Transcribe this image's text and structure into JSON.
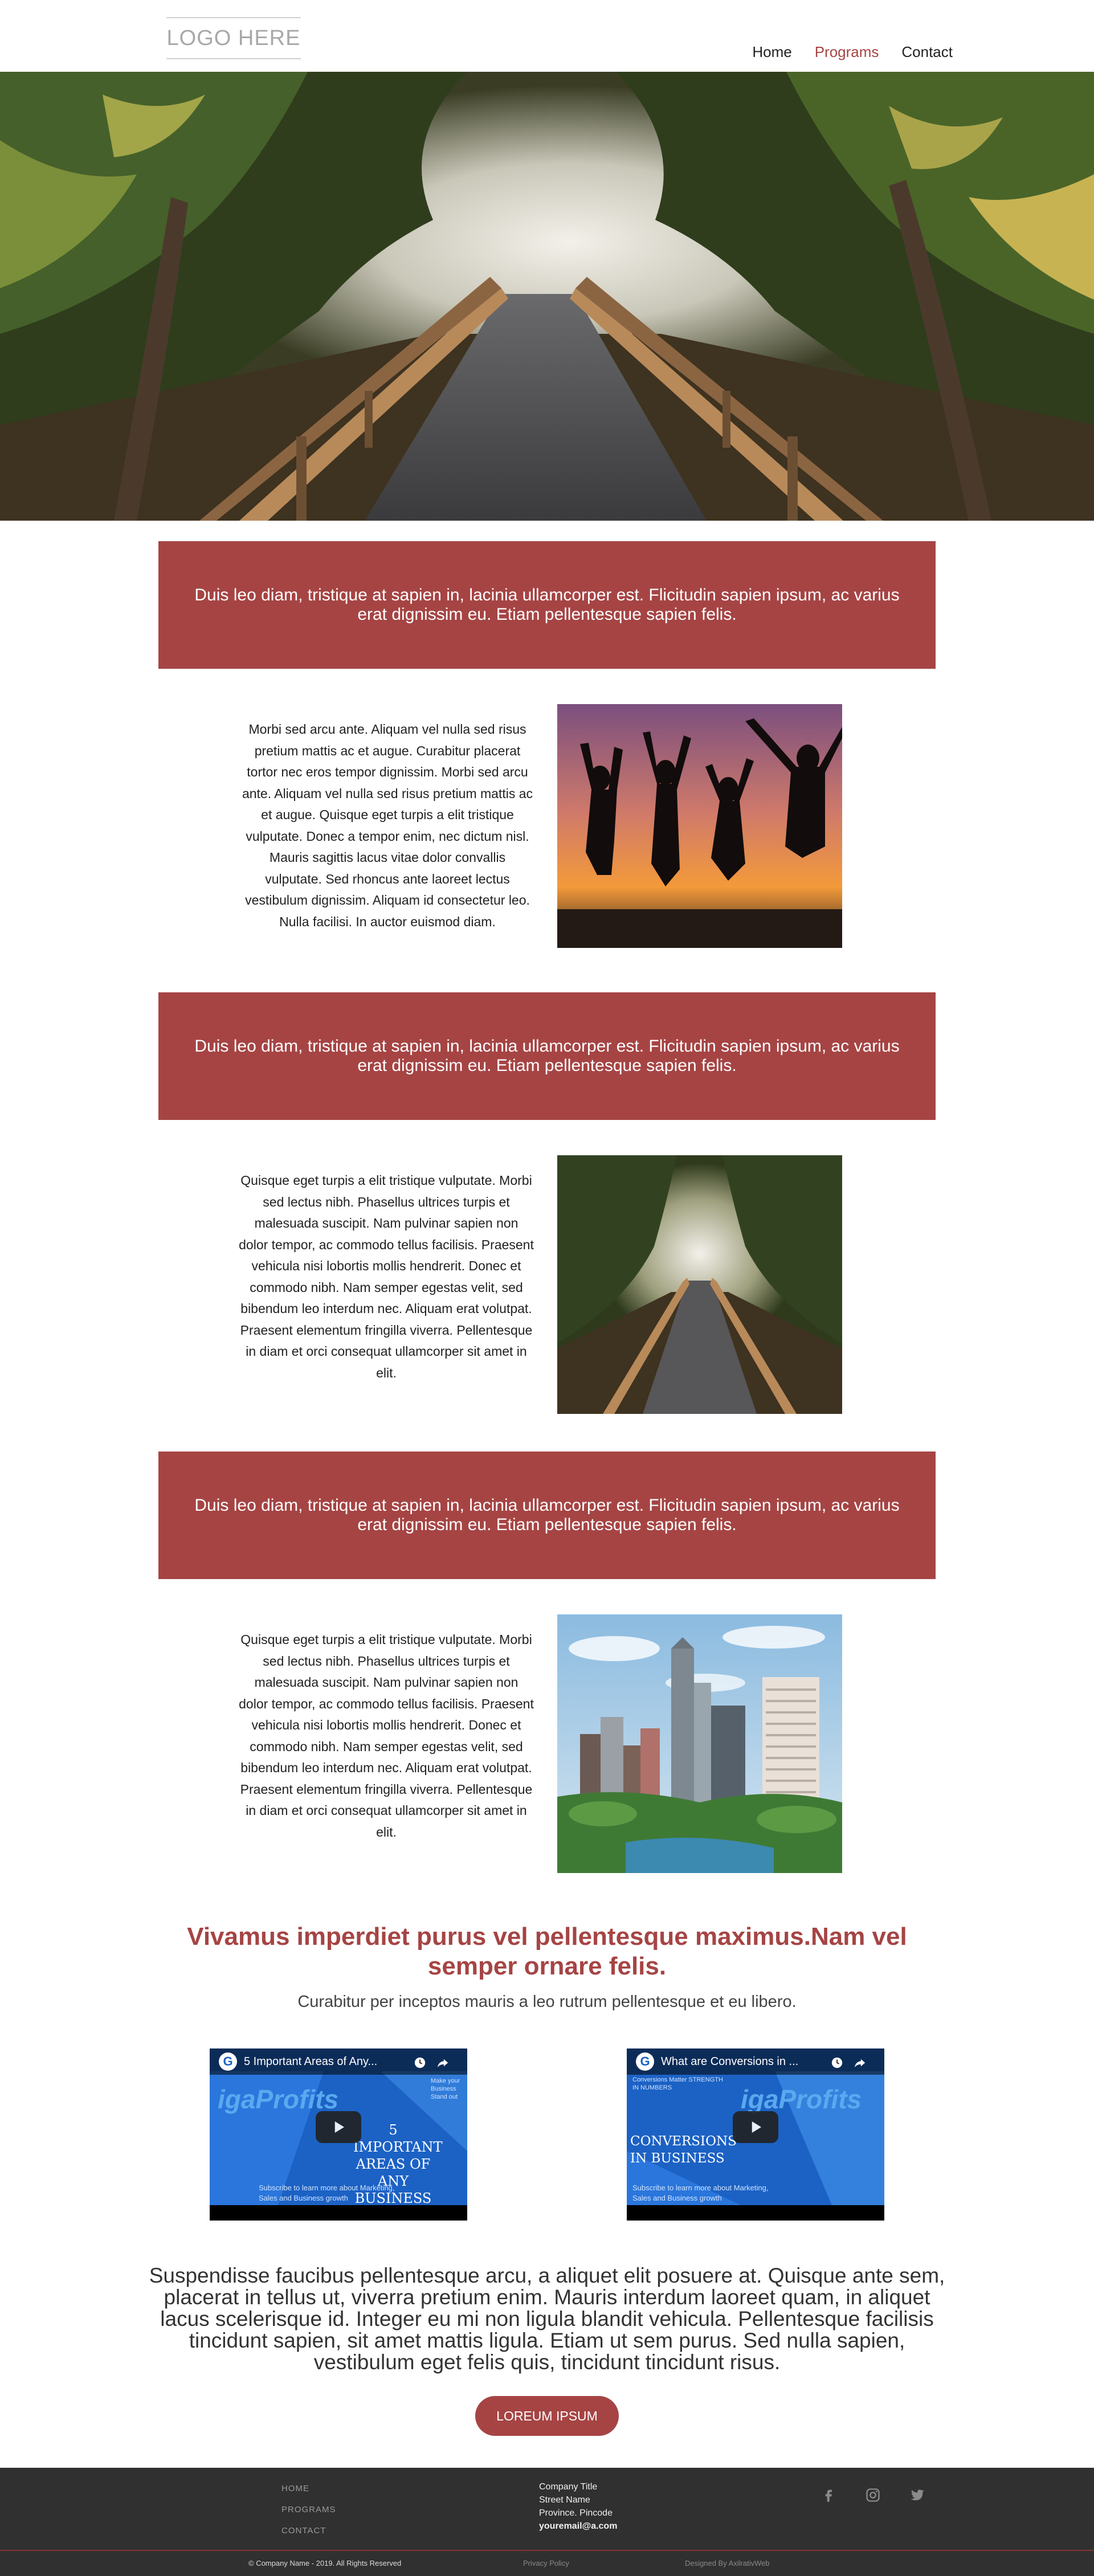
{
  "header": {
    "logo_text": "LOGO HERE",
    "nav": [
      {
        "label": "Home",
        "active": false
      },
      {
        "label": "Programs",
        "active": true
      },
      {
        "label": "Contact",
        "active": false
      }
    ]
  },
  "bands": [
    {
      "text": "Duis leo diam, tristique at sapien in, lacinia ullamcorper est. Flicitudin sapien ipsum, ac varius erat dignissim eu. Etiam pellentesque sapien felis."
    },
    {
      "text": "Duis leo diam, tristique at sapien in, lacinia ullamcorper est. Flicitudin sapien ipsum, ac varius erat dignissim eu. Etiam pellentesque sapien felis."
    },
    {
      "text": "Duis leo diam, tristique at sapien in, lacinia ullamcorper est. Flicitudin sapien ipsum, ac varius erat dignissim eu. Etiam pellentesque sapien felis."
    }
  ],
  "rows": [
    {
      "text": "Morbi sed arcu ante. Aliquam vel nulla sed risus pretium mattis ac et augue. Curabitur placerat tortor nec eros tempor dignissim. Morbi sed arcu ante. Aliquam vel nulla sed risus pretium mattis ac et augue. Quisque eget turpis a elit tristique vulputate. Donec a tempor enim, nec dictum nisl. Mauris sagittis lacus vitae dolor convallis vulputate. Sed rhoncus ante laoreet lectus vestibulum dignissim. Aliquam id consectetur leo. Nulla facilisi. In auctor euismod diam."
    },
    {
      "text": "Quisque eget turpis a elit tristique vulputate. Morbi sed lectus nibh. Phasellus ultrices turpis et malesuada suscipit. Nam pulvinar sapien non dolor tempor, ac commodo tellus facilisis. Praesent vehicula nisi lobortis mollis hendrerit. Donec et commodo nibh. Nam semper egestas velit, sed bibendum leo interdum nec. Aliquam erat volutpat. Praesent elementum fringilla viverra. Pellentesque in diam et orci consequat ullamcorper sit amet in elit."
    },
    {
      "text": "Quisque eget turpis a elit tristique vulputate. Morbi sed lectus nibh. Phasellus ultrices turpis et malesuada suscipit. Nam pulvinar sapien non dolor tempor, ac commodo tellus facilisis. Praesent vehicula nisi lobortis mollis hendrerit. Donec et commodo nibh. Nam semper egestas velit, sed bibendum leo interdum nec. Aliquam erat volutpat. Praesent elementum fringilla viverra. Pellentesque in diam et orci consequat ullamcorper sit amet in elit."
    }
  ],
  "section": {
    "title": "Vivamus imperdiet purus vel pellentesque maximus.Nam vel semper ornare felis.",
    "subtitle": "Curabitur per inceptos mauris a leo rutrum pellentesque et eu libero."
  },
  "videos": [
    {
      "title": "5 Important Areas of Any...",
      "brand": "igaProfits",
      "headline": "5 IMPORTANT AREAS OF ANY BUSINESS",
      "corner_note": "Make your Business Stand out",
      "caption": "Subscribe to learn more about Marketing, Sales and Business growth"
    },
    {
      "title": "What are Conversions in ...",
      "brand": "igaProfits",
      "headline": "CONVERSIONS IN BUSINESS",
      "corner_note": "Conversions Matter STRENGTH IN NUMBERS",
      "caption": "Subscribe to learn more about Marketing, Sales and Business growth"
    }
  ],
  "closing": {
    "paragraph": "Suspendisse faucibus pellentesque arcu, a aliquet elit posuere at. Quisque ante sem, placerat in tellus ut, viverra pretium enim. Mauris interdum laoreet quam, in aliquet lacus scelerisque id. Integer eu mi non ligula blandit vehicula. Pellentesque facilisis tincidunt sapien, sit amet mattis ligula. Etiam ut sem purus. Sed nulla sapien, vestibulum eget felis quis, tincidunt tincidunt risus.",
    "cta_label": "LOREUM IPSUM"
  },
  "footer": {
    "links": [
      "HOME",
      "PROGRAMS",
      "CONTACT"
    ],
    "address": {
      "company": "Company Title",
      "street": "Street Name",
      "province": "Province. Pincode",
      "email": "youremail@a.com"
    },
    "socials": [
      "facebook-icon",
      "instagram-icon",
      "twitter-icon"
    ],
    "copyright": "© Company Name - 2019. All Rights Reserved",
    "privacy": "Privacy Policy",
    "designed_by": "Designed By AxilrativWeb"
  },
  "colors": {
    "accent": "#a64444",
    "footer_bg": "#303030",
    "video_blue": "#1c62c4"
  }
}
